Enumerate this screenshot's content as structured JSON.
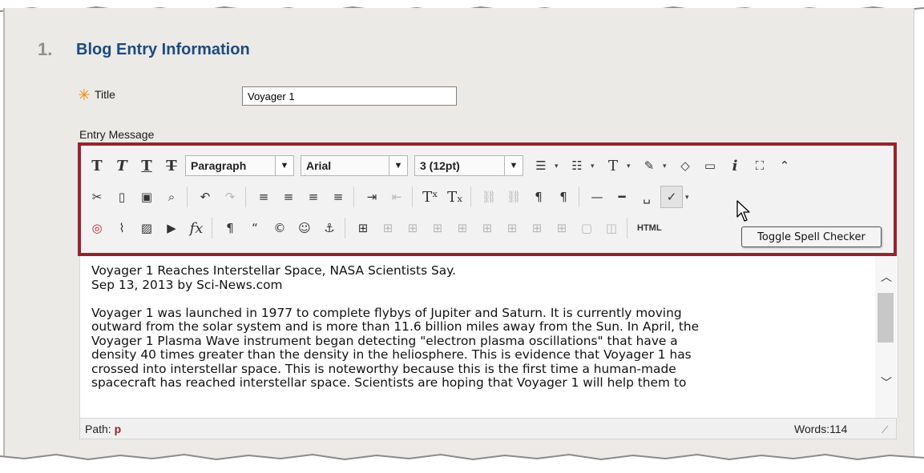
{
  "section": {
    "number": "1.",
    "title": "Blog Entry Information"
  },
  "form": {
    "required_icon": "asterisk-icon",
    "title_label": "Title",
    "title_value": "Voyager 1",
    "entry_label": "Entry Message"
  },
  "toolbar": {
    "format_select": "Paragraph",
    "font_select": "Arial",
    "size_select": "3 (12pt)",
    "tooltip": "Toggle Spell Checker",
    "html_label": "HTML"
  },
  "editor": {
    "lines": [
      "Voyager 1 Reaches Interstellar Space, NASA Scientists Say.",
      "Sep 13, 2013 by Sci-News.com",
      "",
      "Voyager 1 was launched in 1977 to complete flybys of Jupiter and Saturn. It is currently moving",
      "outward from the solar system and is more than 11.6 billion miles away from the Sun. In April, the",
      "Voyager 1 Plasma Wave instrument began detecting \"electron plasma oscillations\" that have a",
      "density 40 times greater than the density in the heliosphere. This is evidence that Voyager 1 has",
      "crossed into interstellar space. This is noteworthy because this is the first time a human-made",
      "spacecraft has reached interstellar space. Scientists are hoping that Voyager 1 will help them to"
    ]
  },
  "status": {
    "path_label": "Path:",
    "path_value": "p",
    "words": "Words:114"
  },
  "colors": {
    "accent_border": "#98232c",
    "title_blue": "#1d4a80",
    "required_orange": "#f08a00"
  }
}
